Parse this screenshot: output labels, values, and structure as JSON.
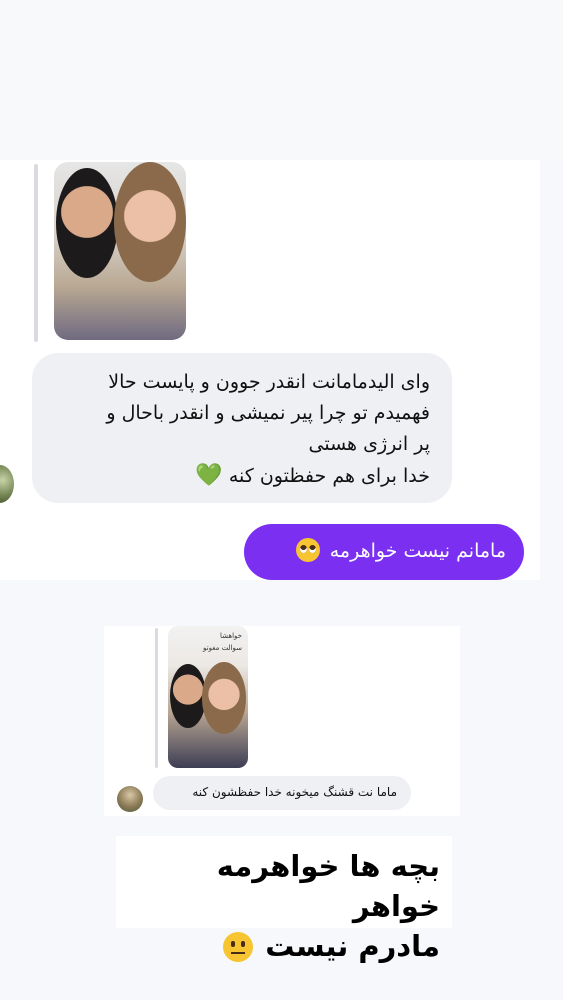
{
  "screenshot_1": {
    "reply_image": {
      "alt": "photo of two women"
    },
    "incoming_message_lines": [
      "وای الیدمامانت انقدر جوون و پایست حالا",
      "فهمیدم تو چرا پیر نمیشی و انقدر باحال و",
      "پر انرژی هستی",
      "خدا برای هم حفظتون کنه"
    ],
    "incoming_message_emoji": "green-heart",
    "outgoing_message": "مامانم نیست خواهرمه",
    "outgoing_message_emoji": "pleading-face",
    "outgoing_bubble_color": "#7b2ff0"
  },
  "screenshot_2": {
    "thumb_overlay_lines": [
      "خواهشا",
      "سوالت مغوتو"
    ],
    "incoming_message": "ماما نت قشنگ میخونه خدا حفظشون کنه"
  },
  "caption": {
    "line1": "بچه ها خواهرمه خواهر",
    "line2": "مادرم نیست",
    "emoji": "neutral-face"
  }
}
